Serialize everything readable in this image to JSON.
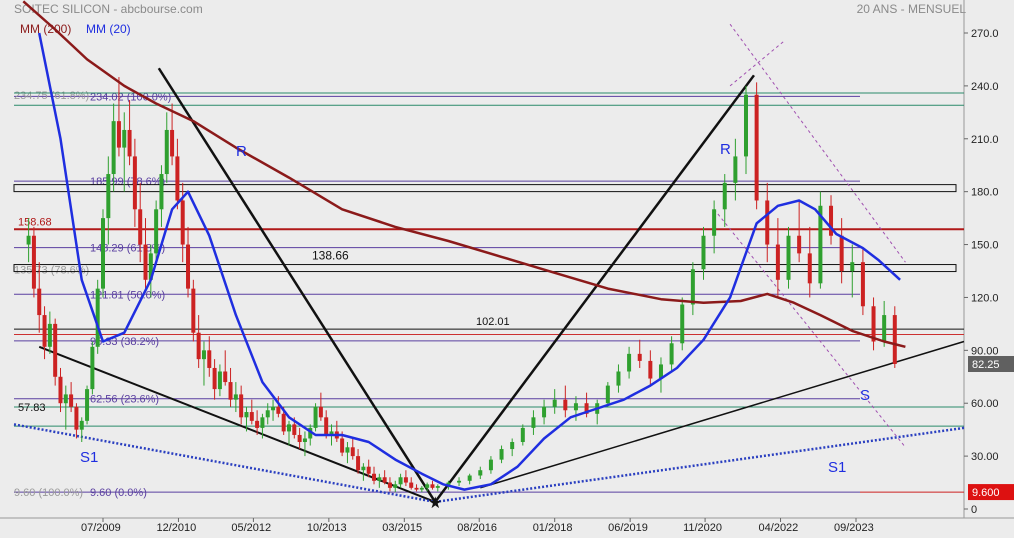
{
  "header": {
    "title": "SOITEC SILICON - abcbourse.com",
    "period": "20 ANS - MENSUEL"
  },
  "chart_data": {
    "type": "candlestick",
    "legend": [
      {
        "name": "MM (200)",
        "color": "#8b1a1a"
      },
      {
        "name": "MM (20)",
        "color": "#1f2ee0"
      }
    ],
    "ylim": [
      0,
      275
    ],
    "y_ticks": [
      {
        "v": 270,
        "label": "270.0"
      },
      {
        "v": 240,
        "label": "240.0"
      },
      {
        "v": 210,
        "label": "210.0"
      },
      {
        "v": 180,
        "label": "180.0"
      },
      {
        "v": 150,
        "label": "150.0"
      },
      {
        "v": 120,
        "label": "120.0"
      },
      {
        "v": 90,
        "label": "90.00"
      },
      {
        "v": 60,
        "label": "60.00"
      },
      {
        "v": 30,
        "label": "30.00"
      },
      {
        "v": 0,
        "label": "0"
      }
    ],
    "x_ticks": [
      {
        "t": 2009.5,
        "label": "07/2009"
      },
      {
        "t": 2010.92,
        "label": "12/2010"
      },
      {
        "t": 2012.33,
        "label": "05/2012"
      },
      {
        "t": 2013.75,
        "label": "10/2013"
      },
      {
        "t": 2015.17,
        "label": "03/2015"
      },
      {
        "t": 2016.58,
        "label": "08/2016"
      },
      {
        "t": 2018.0,
        "label": "01/2018"
      },
      {
        "t": 2019.42,
        "label": "06/2019"
      },
      {
        "t": 2020.83,
        "label": "11/2020"
      },
      {
        "t": 2022.25,
        "label": "04/2022"
      },
      {
        "t": 2023.67,
        "label": "09/2023"
      }
    ],
    "last_price": {
      "value": 82.25,
      "label": "82.25"
    },
    "low_marker": {
      "value": 9.6,
      "label": "9.600"
    },
    "fib_labels": [
      {
        "v": 234.02,
        "label": "234.02 (100.0%)"
      },
      {
        "v": 185.99,
        "label": "185.99 (78.6%)"
      },
      {
        "v": 148.29,
        "label": "148.29 (61.8%)"
      },
      {
        "v": 121.81,
        "label": "121.81 (50.0%)"
      },
      {
        "v": 95.33,
        "label": "95.33 (38.2%)"
      },
      {
        "v": 62.56,
        "label": "62.56 (23.6%)"
      },
      {
        "v": 9.6,
        "label": "9.60 (0.0%)"
      }
    ],
    "fib_left_labels": [
      {
        "v": 234.75,
        "label": "234.75 (61.8%)"
      },
      {
        "v": 135.73,
        "label": "135.73 (78.6%)"
      },
      {
        "v": 9.6,
        "label": "9.60 (100.0%)"
      }
    ],
    "levels": [
      {
        "v": 158.68,
        "label": "158.68"
      },
      {
        "v": 138.66,
        "label": "138.66"
      },
      {
        "v": 102.01,
        "label": "102.01"
      },
      {
        "v": 57.83,
        "label": "57.83"
      },
      {
        "v": 9.6,
        "label": "9.60"
      }
    ],
    "annotations": [
      "R",
      "R",
      "S",
      "S1",
      "S1"
    ],
    "series": [
      {
        "name": "MM (200)",
        "values_by_date": [
          [
            2008.0,
            288
          ],
          [
            2008.6,
            272
          ],
          [
            2009.2,
            255
          ],
          [
            2009.9,
            240
          ],
          [
            2010.5,
            230
          ],
          [
            2011.2,
            220
          ],
          [
            2012.0,
            205
          ],
          [
            2013.0,
            188
          ],
          [
            2014.0,
            170
          ],
          [
            2015.0,
            160
          ],
          [
            2016.0,
            152
          ],
          [
            2017.0,
            143
          ],
          [
            2018.0,
            134
          ],
          [
            2019.0,
            125
          ],
          [
            2020.0,
            119
          ],
          [
            2020.8,
            117
          ],
          [
            2021.5,
            118
          ],
          [
            2022.0,
            122
          ],
          [
            2022.5,
            117
          ],
          [
            2023.0,
            110
          ],
          [
            2023.6,
            101
          ],
          [
            2024.2,
            95
          ],
          [
            2024.6,
            92
          ]
        ]
      },
      {
        "name": "MM (20)",
        "values_by_date": [
          [
            2008.3,
            270
          ],
          [
            2008.7,
            210
          ],
          [
            2009.1,
            130
          ],
          [
            2009.5,
            95
          ],
          [
            2009.9,
            100
          ],
          [
            2010.4,
            130
          ],
          [
            2010.8,
            170
          ],
          [
            2011.1,
            180
          ],
          [
            2011.5,
            155
          ],
          [
            2012.0,
            110
          ],
          [
            2012.5,
            72
          ],
          [
            2013.0,
            52
          ],
          [
            2013.5,
            42
          ],
          [
            2014.0,
            42
          ],
          [
            2014.5,
            38
          ],
          [
            2015.0,
            28
          ],
          [
            2015.5,
            20
          ],
          [
            2015.9,
            14
          ],
          [
            2016.3,
            11
          ],
          [
            2016.8,
            14
          ],
          [
            2017.3,
            24
          ],
          [
            2017.8,
            40
          ],
          [
            2018.3,
            52
          ],
          [
            2018.8,
            57
          ],
          [
            2019.3,
            62
          ],
          [
            2019.8,
            70
          ],
          [
            2020.3,
            80
          ],
          [
            2020.8,
            96
          ],
          [
            2021.3,
            120
          ],
          [
            2021.8,
            162
          ],
          [
            2022.2,
            172
          ],
          [
            2022.6,
            175
          ],
          [
            2022.9,
            170
          ],
          [
            2023.3,
            156
          ],
          [
            2023.8,
            148
          ],
          [
            2024.1,
            141
          ],
          [
            2024.5,
            130
          ]
        ]
      }
    ],
    "candles_sample_note": "",
    "candles": [
      [
        2008.1,
        150,
        165,
        140,
        155
      ],
      [
        2008.2,
        155,
        160,
        120,
        125
      ],
      [
        2008.3,
        125,
        140,
        100,
        110
      ],
      [
        2008.4,
        110,
        115,
        85,
        92
      ],
      [
        2008.5,
        92,
        112,
        88,
        105
      ],
      [
        2008.6,
        105,
        108,
        70,
        75
      ],
      [
        2008.7,
        75,
        80,
        55,
        60
      ],
      [
        2008.8,
        60,
        70,
        45,
        65
      ],
      [
        2008.9,
        65,
        72,
        55,
        58
      ],
      [
        2009.0,
        58,
        60,
        40,
        45
      ],
      [
        2009.1,
        45,
        52,
        38,
        50
      ],
      [
        2009.2,
        50,
        70,
        48,
        68
      ],
      [
        2009.3,
        68,
        95,
        65,
        92
      ],
      [
        2009.4,
        92,
        130,
        88,
        125
      ],
      [
        2009.5,
        125,
        170,
        120,
        165
      ],
      [
        2009.6,
        165,
        200,
        150,
        190
      ],
      [
        2009.7,
        190,
        230,
        180,
        220
      ],
      [
        2009.8,
        220,
        245,
        200,
        205
      ],
      [
        2009.9,
        205,
        225,
        180,
        215
      ],
      [
        2010.0,
        215,
        232,
        195,
        200
      ],
      [
        2010.1,
        200,
        210,
        160,
        170
      ],
      [
        2010.2,
        170,
        185,
        140,
        150
      ],
      [
        2010.3,
        150,
        165,
        125,
        130
      ],
      [
        2010.4,
        130,
        150,
        120,
        145
      ],
      [
        2010.5,
        145,
        175,
        140,
        170
      ],
      [
        2010.6,
        170,
        195,
        160,
        190
      ],
      [
        2010.7,
        190,
        225,
        185,
        215
      ],
      [
        2010.8,
        215,
        230,
        195,
        200
      ],
      [
        2010.9,
        200,
        210,
        170,
        175
      ],
      [
        2011.0,
        175,
        185,
        140,
        150
      ],
      [
        2011.1,
        150,
        160,
        120,
        125
      ],
      [
        2011.2,
        125,
        130,
        95,
        100
      ],
      [
        2011.3,
        100,
        110,
        80,
        85
      ],
      [
        2011.4,
        85,
        95,
        70,
        90
      ],
      [
        2011.5,
        90,
        98,
        75,
        80
      ],
      [
        2011.6,
        80,
        85,
        62,
        68
      ],
      [
        2011.7,
        68,
        82,
        64,
        78
      ],
      [
        2011.8,
        78,
        90,
        70,
        72
      ],
      [
        2011.9,
        72,
        80,
        58,
        62
      ],
      [
        2012.0,
        62,
        72,
        55,
        65
      ],
      [
        2012.1,
        65,
        70,
        48,
        52
      ],
      [
        2012.2,
        52,
        58,
        44,
        55
      ],
      [
        2012.3,
        55,
        62,
        48,
        50
      ],
      [
        2012.4,
        50,
        56,
        42,
        46
      ],
      [
        2012.5,
        46,
        54,
        40,
        52
      ],
      [
        2012.6,
        52,
        60,
        48,
        56
      ],
      [
        2012.7,
        56,
        62,
        50,
        58
      ],
      [
        2012.8,
        58,
        64,
        52,
        54
      ],
      [
        2012.9,
        54,
        58,
        42,
        44
      ],
      [
        2013.0,
        44,
        50,
        36,
        48
      ],
      [
        2013.1,
        48,
        52,
        40,
        42
      ],
      [
        2013.2,
        42,
        46,
        34,
        38
      ],
      [
        2013.3,
        38,
        44,
        30,
        40
      ],
      [
        2013.4,
        40,
        48,
        36,
        46
      ],
      [
        2013.5,
        46,
        60,
        44,
        58
      ],
      [
        2013.6,
        58,
        66,
        50,
        52
      ],
      [
        2013.7,
        52,
        56,
        40,
        42
      ],
      [
        2013.8,
        42,
        48,
        36,
        44
      ],
      [
        2013.9,
        44,
        50,
        38,
        40
      ],
      [
        2014.0,
        40,
        44,
        30,
        32
      ],
      [
        2014.1,
        32,
        38,
        26,
        35
      ],
      [
        2014.2,
        35,
        40,
        28,
        30
      ],
      [
        2014.3,
        30,
        34,
        20,
        22
      ],
      [
        2014.4,
        22,
        26,
        16,
        24
      ],
      [
        2014.5,
        24,
        28,
        18,
        20
      ],
      [
        2014.6,
        20,
        24,
        14,
        16
      ],
      [
        2014.7,
        16,
        20,
        12,
        18
      ],
      [
        2014.8,
        18,
        22,
        14,
        15
      ],
      [
        2014.9,
        15,
        18,
        10,
        12
      ],
      [
        2015.0,
        12,
        16,
        9.6,
        14
      ],
      [
        2015.1,
        14,
        20,
        12,
        18
      ],
      [
        2015.2,
        18,
        22,
        13,
        15
      ],
      [
        2015.3,
        15,
        18,
        11,
        12
      ],
      [
        2015.4,
        12,
        14,
        10,
        11
      ],
      [
        2015.5,
        11,
        13,
        9.6,
        12
      ],
      [
        2015.6,
        12,
        15,
        10,
        14
      ],
      [
        2015.7,
        14,
        16,
        11,
        12
      ],
      [
        2015.8,
        12,
        14,
        10,
        13
      ],
      [
        2016.0,
        13,
        16,
        11,
        15
      ],
      [
        2016.2,
        15,
        18,
        13,
        16
      ],
      [
        2016.4,
        16,
        20,
        14,
        19
      ],
      [
        2016.6,
        19,
        24,
        17,
        22
      ],
      [
        2016.8,
        22,
        30,
        20,
        28
      ],
      [
        2017.0,
        28,
        36,
        26,
        34
      ],
      [
        2017.2,
        34,
        40,
        30,
        38
      ],
      [
        2017.4,
        38,
        48,
        36,
        46
      ],
      [
        2017.6,
        46,
        56,
        42,
        52
      ],
      [
        2017.8,
        52,
        62,
        48,
        58
      ],
      [
        2018.0,
        58,
        68,
        54,
        62
      ],
      [
        2018.2,
        62,
        70,
        52,
        56
      ],
      [
        2018.4,
        56,
        64,
        50,
        60
      ],
      [
        2018.6,
        60,
        66,
        52,
        54
      ],
      [
        2018.8,
        54,
        62,
        48,
        60
      ],
      [
        2019.0,
        60,
        72,
        58,
        70
      ],
      [
        2019.2,
        70,
        82,
        66,
        78
      ],
      [
        2019.4,
        78,
        92,
        74,
        88
      ],
      [
        2019.6,
        88,
        96,
        80,
        84
      ],
      [
        2019.8,
        84,
        90,
        70,
        74
      ],
      [
        2020.0,
        74,
        86,
        66,
        82
      ],
      [
        2020.2,
        82,
        98,
        78,
        94
      ],
      [
        2020.4,
        94,
        120,
        90,
        116
      ],
      [
        2020.6,
        116,
        140,
        110,
        136
      ],
      [
        2020.8,
        136,
        160,
        130,
        155
      ],
      [
        2021.0,
        155,
        175,
        145,
        170
      ],
      [
        2021.2,
        170,
        190,
        160,
        185
      ],
      [
        2021.4,
        185,
        210,
        175,
        200
      ],
      [
        2021.6,
        200,
        240,
        190,
        235
      ],
      [
        2021.8,
        235,
        242,
        170,
        175
      ],
      [
        2022.0,
        175,
        185,
        140,
        150
      ],
      [
        2022.2,
        150,
        165,
        120,
        130
      ],
      [
        2022.4,
        130,
        160,
        125,
        155
      ],
      [
        2022.6,
        155,
        175,
        140,
        145
      ],
      [
        2022.8,
        145,
        160,
        120,
        128
      ],
      [
        2023.0,
        128,
        180,
        125,
        172
      ],
      [
        2023.2,
        172,
        178,
        150,
        155
      ],
      [
        2023.4,
        155,
        165,
        128,
        135
      ],
      [
        2023.6,
        135,
        150,
        120,
        140
      ],
      [
        2023.8,
        140,
        148,
        110,
        115
      ],
      [
        2024.0,
        115,
        120,
        90,
        95
      ],
      [
        2024.2,
        95,
        118,
        92,
        110
      ],
      [
        2024.4,
        110,
        115,
        80,
        82.25
      ]
    ]
  }
}
